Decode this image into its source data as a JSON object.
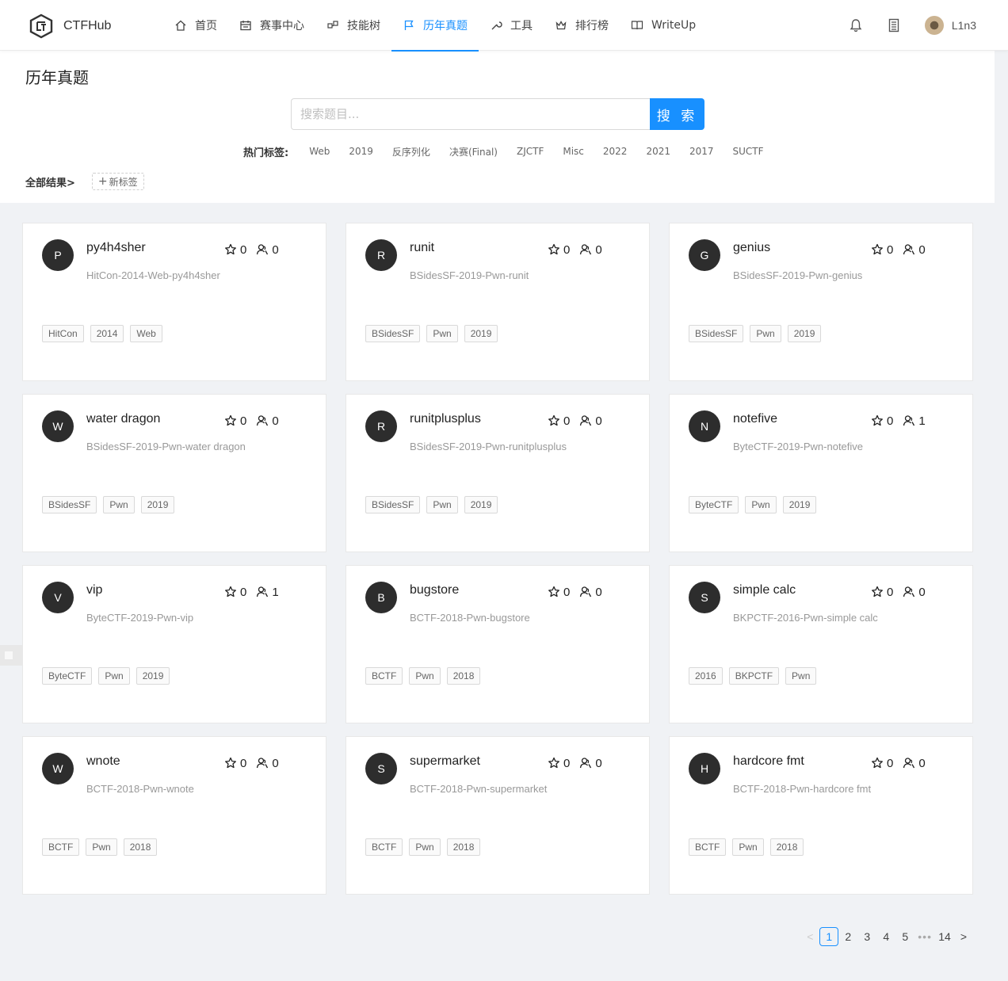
{
  "header": {
    "brand": "CTFHub",
    "nav": [
      {
        "label": "首页",
        "icon": "home-icon"
      },
      {
        "label": "赛事中心",
        "icon": "calendar-icon"
      },
      {
        "label": "技能树",
        "icon": "skill-tree-icon"
      },
      {
        "label": "历年真题",
        "icon": "flag-icon",
        "active": true
      },
      {
        "label": "工具",
        "icon": "wrench-icon"
      },
      {
        "label": "排行榜",
        "icon": "crown-icon"
      },
      {
        "label": "WriteUp",
        "icon": "book-icon"
      }
    ],
    "username": "L1n3",
    "accent_color": "#1890ff"
  },
  "search": {
    "page_title": "历年真题",
    "placeholder": "搜索题目...",
    "button_label": "搜 索",
    "hot_label": "热门标签:",
    "hot_tags": [
      "Web",
      "2019",
      "反序列化",
      "决赛(Final)",
      "ZJCTF",
      "Misc",
      "2022",
      "2021",
      "2017",
      "SUCTF"
    ],
    "result_label": "全部结果>",
    "new_tag_label": "新标签"
  },
  "cards": [
    {
      "avatar": "P",
      "title": "py4h4sher",
      "stars": "0",
      "solvers": "0",
      "desc": "HitCon-2014-Web-py4h4sher",
      "tags": [
        "HitCon",
        "2014",
        "Web"
      ]
    },
    {
      "avatar": "R",
      "title": "runit",
      "stars": "0",
      "solvers": "0",
      "desc": "BSidesSF-2019-Pwn-runit",
      "tags": [
        "BSidesSF",
        "Pwn",
        "2019"
      ]
    },
    {
      "avatar": "G",
      "title": "genius",
      "stars": "0",
      "solvers": "0",
      "desc": "BSidesSF-2019-Pwn-genius",
      "tags": [
        "BSidesSF",
        "Pwn",
        "2019"
      ]
    },
    {
      "avatar": "W",
      "title": "water dragon",
      "stars": "0",
      "solvers": "0",
      "desc": "BSidesSF-2019-Pwn-water dragon",
      "tags": [
        "BSidesSF",
        "Pwn",
        "2019"
      ]
    },
    {
      "avatar": "R",
      "title": "runitplusplus",
      "stars": "0",
      "solvers": "0",
      "desc": "BSidesSF-2019-Pwn-runitplusplus",
      "tags": [
        "BSidesSF",
        "Pwn",
        "2019"
      ]
    },
    {
      "avatar": "N",
      "title": "notefive",
      "stars": "0",
      "solvers": "1",
      "desc": "ByteCTF-2019-Pwn-notefive",
      "tags": [
        "ByteCTF",
        "Pwn",
        "2019"
      ]
    },
    {
      "avatar": "V",
      "title": "vip",
      "stars": "0",
      "solvers": "1",
      "desc": "ByteCTF-2019-Pwn-vip",
      "tags": [
        "ByteCTF",
        "Pwn",
        "2019"
      ]
    },
    {
      "avatar": "B",
      "title": "bugstore",
      "stars": "0",
      "solvers": "0",
      "desc": "BCTF-2018-Pwn-bugstore",
      "tags": [
        "BCTF",
        "Pwn",
        "2018"
      ]
    },
    {
      "avatar": "S",
      "title": "simple calc",
      "stars": "0",
      "solvers": "0",
      "desc": "BKPCTF-2016-Pwn-simple calc",
      "tags": [
        "2016",
        "BKPCTF",
        "Pwn"
      ]
    },
    {
      "avatar": "W",
      "title": "wnote",
      "stars": "0",
      "solvers": "0",
      "desc": "BCTF-2018-Pwn-wnote",
      "tags": [
        "BCTF",
        "Pwn",
        "2018"
      ]
    },
    {
      "avatar": "S",
      "title": "supermarket",
      "stars": "0",
      "solvers": "0",
      "desc": "BCTF-2018-Pwn-supermarket",
      "tags": [
        "BCTF",
        "Pwn",
        "2018"
      ]
    },
    {
      "avatar": "H",
      "title": "hardcore fmt",
      "stars": "0",
      "solvers": "0",
      "desc": "BCTF-2018-Pwn-hardcore fmt",
      "tags": [
        "BCTF",
        "Pwn",
        "2018"
      ]
    }
  ],
  "pagination": {
    "pages": [
      "1",
      "2",
      "3",
      "4",
      "5"
    ],
    "current": "1",
    "ellipsis": "•••",
    "last": "14",
    "prev": "<",
    "next": ">"
  }
}
